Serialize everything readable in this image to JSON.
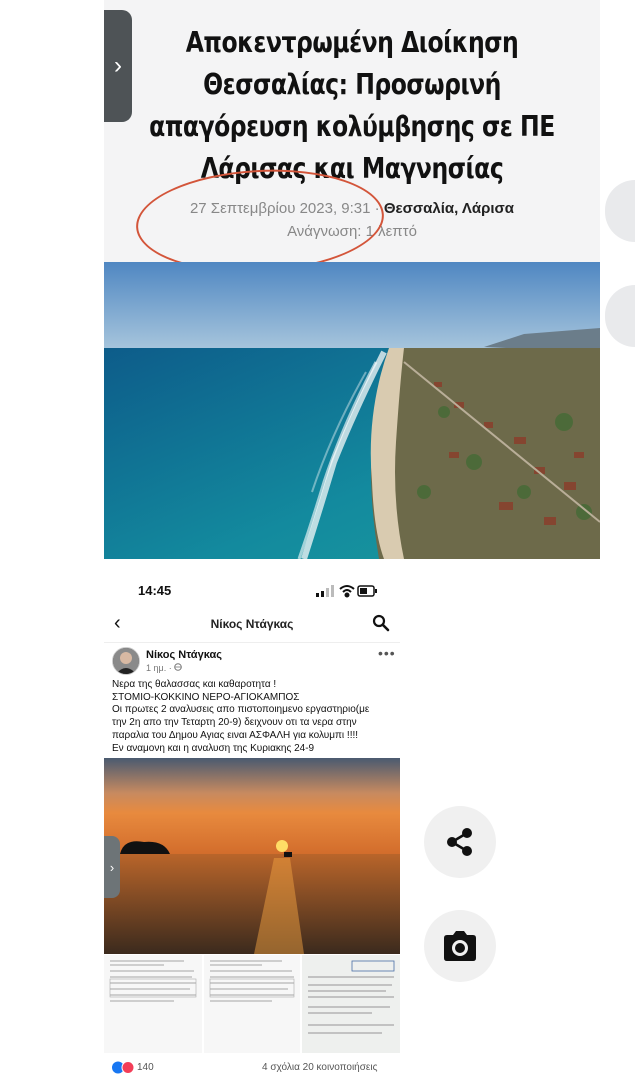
{
  "article": {
    "title": "Αποκεντρωμένη Διοίκηση Θεσσαλίας: Προσωρινή απαγόρευση κολύμβησης σε ΠΕ Λάρισας και Μαγνησίας",
    "date": "27 Σεπτεμβρίου 2023, 9:31",
    "separator": "·",
    "tags": "Θεσσαλία, Λάρισα",
    "reading_time": "Ανάγνωση: 1 λεπτό"
  },
  "drawer_tab_icon": "›",
  "phone": {
    "status_time": "14:45",
    "header_title": "Νίκος Ντάγκας",
    "back_icon": "‹"
  },
  "post": {
    "author": "Νίκος Ντάγκας",
    "time": "1 ημ. ·",
    "more_icon": "•••",
    "lines": [
      "Νερα της θαλασσας και καθαροτητα !",
      "ΣΤΟΜΙΟ-ΚΟΚΚΙΝΟ ΝΕΡΟ-ΑΓΙΟΚΑΜΠΟΣ",
      "Οι πρωτες 2 αναλυσεις απο πιστοποιημενο εργαστηριο(με",
      "την 2η απο την Τεταρτη 20-9)  δειχνουν οτι τα νερα στην",
      "παραλια του Δημου Αγιας ειναι ΑΣΦΑΛΗ για κολυμπι !!!!",
      "Εν αναμονη και η αναλυση της Κυριακης 24-9"
    ],
    "reaction_count": "140",
    "comments_shares": "4 σχόλια  20 κοινοποιήσεις"
  },
  "icons": {
    "share": "share-icon",
    "camera": "camera-icon",
    "search": "search-icon"
  },
  "colors": {
    "annotation_circle": "#d3553a",
    "like_blue": "#1877f2",
    "love_red": "#f33e58"
  }
}
